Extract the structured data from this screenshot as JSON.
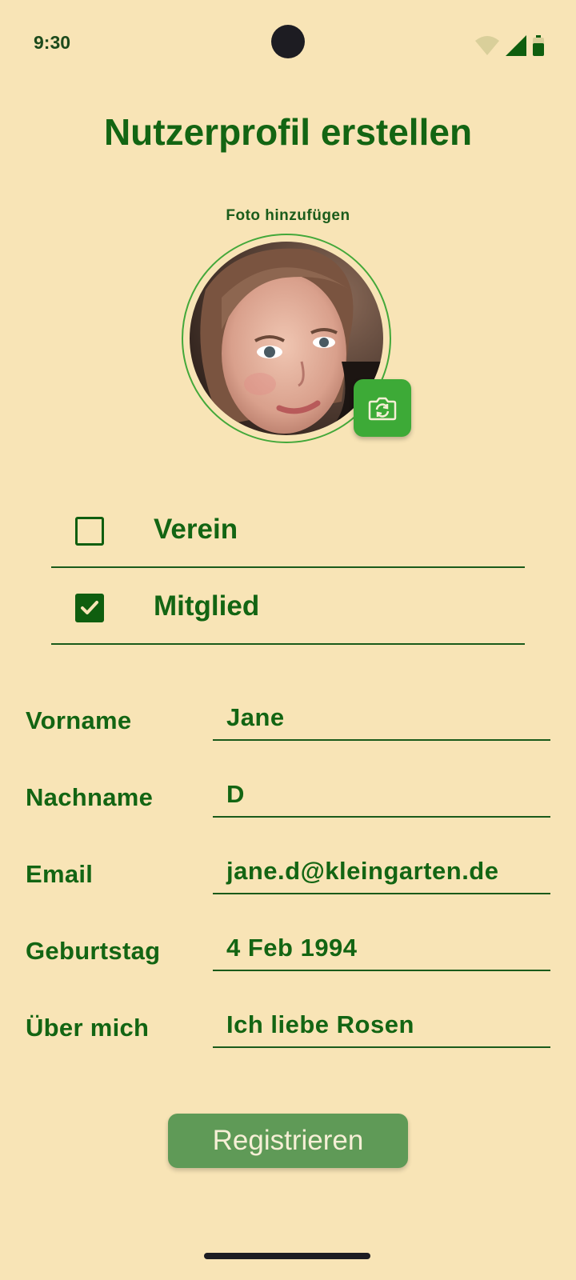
{
  "status_bar": {
    "time": "9:30"
  },
  "page": {
    "title": "Nutzerprofil erstellen"
  },
  "photo": {
    "label": "Foto hinzufügen"
  },
  "checkboxes": [
    {
      "label": "Verein",
      "checked": false
    },
    {
      "label": "Mitglied",
      "checked": true
    }
  ],
  "form": {
    "vorname": {
      "label": "Vorname",
      "value": "Jane"
    },
    "nachname": {
      "label": "Nachname",
      "value": "D"
    },
    "email": {
      "label": "Email",
      "value": "jane.d@kleingarten.de"
    },
    "geburtstag": {
      "label": "Geburtstag",
      "value": "4 Feb 1994"
    },
    "ueber_mich": {
      "label": "Über mich",
      "value": "Ich liebe Rosen"
    }
  },
  "actions": {
    "register_label": "Registrieren"
  },
  "colors": {
    "background": "#f8e4b6",
    "primary_text": "#136513",
    "accent": "#3daa37",
    "button": "#5f9a57"
  }
}
